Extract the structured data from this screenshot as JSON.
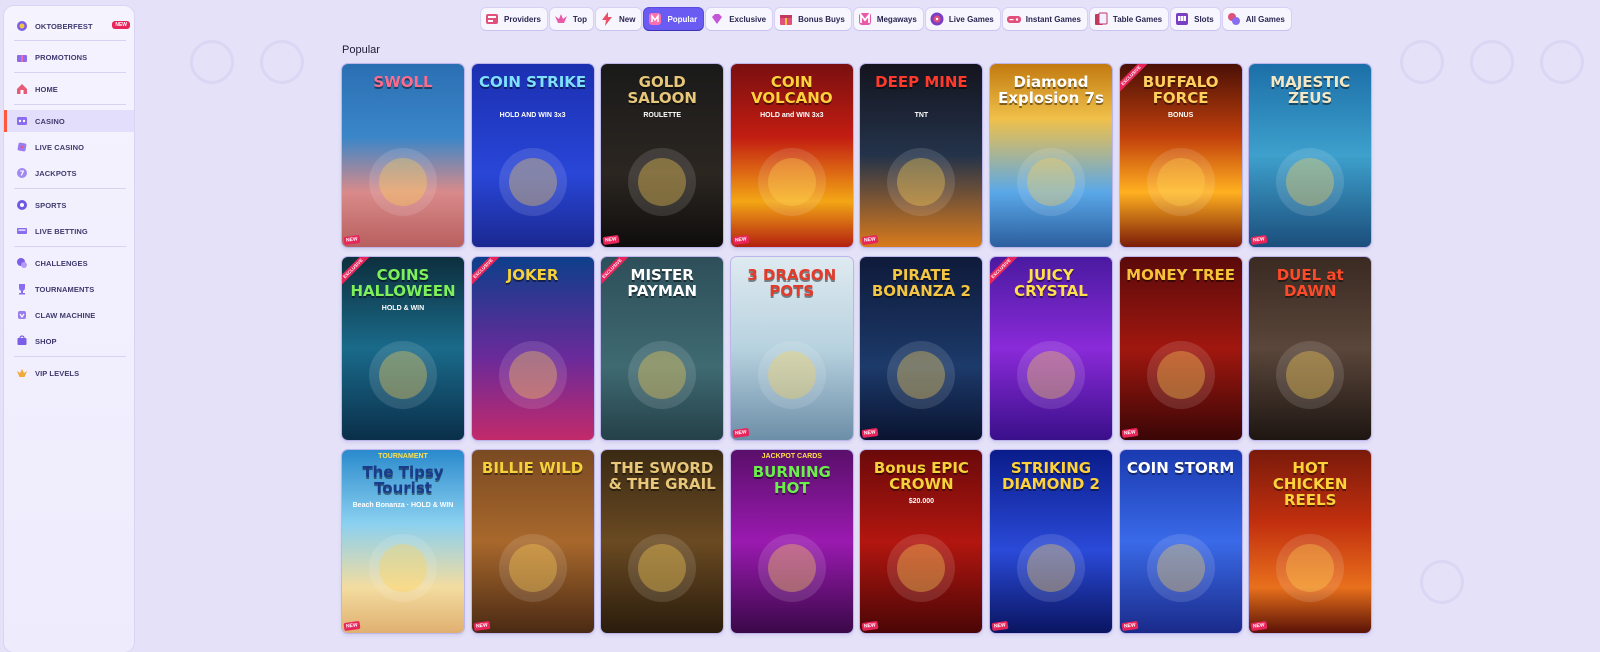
{
  "sidebar": {
    "items": [
      {
        "label": "OKTOBERFEST",
        "icon": "oktoberfest-icon",
        "badge": "NEW"
      },
      {
        "label": "PROMOTIONS",
        "icon": "gift-icon"
      },
      {
        "label": "HOME",
        "icon": "home-icon"
      },
      {
        "label": "CASINO",
        "icon": "casino-icon"
      },
      {
        "label": "LIVE CASINO",
        "icon": "live-casino-icon"
      },
      {
        "label": "JACKPOTS",
        "icon": "jackpots-icon"
      },
      {
        "label": "SPORTS",
        "icon": "sports-icon"
      },
      {
        "label": "LIVE BETTING",
        "icon": "live-betting-icon"
      },
      {
        "label": "CHALLENGES",
        "icon": "challenges-icon"
      },
      {
        "label": "TOURNAMENTS",
        "icon": "trophy-icon"
      },
      {
        "label": "CLAW MACHINE",
        "icon": "claw-icon"
      },
      {
        "label": "SHOP",
        "icon": "shop-icon"
      },
      {
        "label": "VIP LEVELS",
        "icon": "vip-icon"
      }
    ]
  },
  "tabs": [
    {
      "label": "Providers"
    },
    {
      "label": "Top"
    },
    {
      "label": "New"
    },
    {
      "label": "Popular",
      "active": true
    },
    {
      "label": "Exclusive"
    },
    {
      "label": "Bonus Buys"
    },
    {
      "label": "Megaways"
    },
    {
      "label": "Live Games"
    },
    {
      "label": "Instant Games"
    },
    {
      "label": "Table Games"
    },
    {
      "label": "Slots"
    },
    {
      "label": "All Games"
    }
  ],
  "section_title": "Popular",
  "games": [
    {
      "title": "SWOLL",
      "sub": "",
      "tag": "NEW",
      "ribbon": ""
    },
    {
      "title": "COIN STRIKE",
      "sub": "HOLD AND WIN 3x3",
      "tag": "",
      "ribbon": ""
    },
    {
      "title": "GOLD SALOON",
      "sub": "ROULETTE",
      "tag": "NEW",
      "ribbon": ""
    },
    {
      "title": "COIN VOLCANO",
      "sub": "HOLD and WIN 3x3",
      "tag": "NEW",
      "ribbon": ""
    },
    {
      "title": "DEEP MINE",
      "sub": "TNT",
      "tag": "NEW",
      "ribbon": ""
    },
    {
      "title": "Diamond Explosion 7s",
      "sub": "",
      "tag": "",
      "ribbon": ""
    },
    {
      "title": "BUFFALO FORCE",
      "sub": "BONUS",
      "tag": "",
      "ribbon": "EXCLUSIVE"
    },
    {
      "title": "MAJESTIC ZEUS",
      "sub": "",
      "tag": "NEW",
      "ribbon": ""
    },
    {
      "title": "COINS HALLOWEEN",
      "sub": "HOLD & WIN",
      "tag": "",
      "ribbon": "EXCLUSIVE"
    },
    {
      "title": "JOKER",
      "sub": "",
      "tag": "",
      "ribbon": "EXCLUSIVE"
    },
    {
      "title": "MISTER PAYMAN",
      "sub": "",
      "tag": "",
      "ribbon": "EXCLUSIVE"
    },
    {
      "title": "3 DRAGON POTS",
      "sub": "",
      "tag": "NEW",
      "ribbon": ""
    },
    {
      "title": "PIRATE BONANZA 2",
      "sub": "",
      "tag": "NEW",
      "ribbon": ""
    },
    {
      "title": "JUICY CRYSTAL",
      "sub": "",
      "tag": "",
      "ribbon": "EXCLUSIVE"
    },
    {
      "title": "MONEY TREE",
      "sub": "",
      "tag": "NEW",
      "ribbon": ""
    },
    {
      "title": "DUEL at DAWN",
      "sub": "",
      "tag": "",
      "ribbon": ""
    },
    {
      "title": "The Tipsy Tourist",
      "sub": "Beach Bonanza · HOLD & WIN",
      "tag": "NEW",
      "ribbon": "",
      "top": "TOURNAMENT"
    },
    {
      "title": "BILLIE WILD",
      "sub": "",
      "tag": "NEW",
      "ribbon": ""
    },
    {
      "title": "THE SWORD & THE GRAIL",
      "sub": "",
      "tag": "",
      "ribbon": ""
    },
    {
      "title": "BURNING HOT",
      "sub": "",
      "tag": "",
      "ribbon": "",
      "top": "JACKPOT CARDS"
    },
    {
      "title": "Bonus EPIC CROWN",
      "sub": "$20.000",
      "tag": "NEW",
      "ribbon": ""
    },
    {
      "title": "STRIKING DIAMOND 2",
      "sub": "",
      "tag": "NEW",
      "ribbon": ""
    },
    {
      "title": "COIN STORM",
      "sub": "",
      "tag": "NEW",
      "ribbon": ""
    },
    {
      "title": "HOT CHICKEN REELS",
      "sub": "",
      "tag": "NEW",
      "ribbon": ""
    }
  ],
  "colors": {
    "accent": "#6a5cf2",
    "badge": "#e8245b",
    "active_marker": "#ff5a3c"
  }
}
